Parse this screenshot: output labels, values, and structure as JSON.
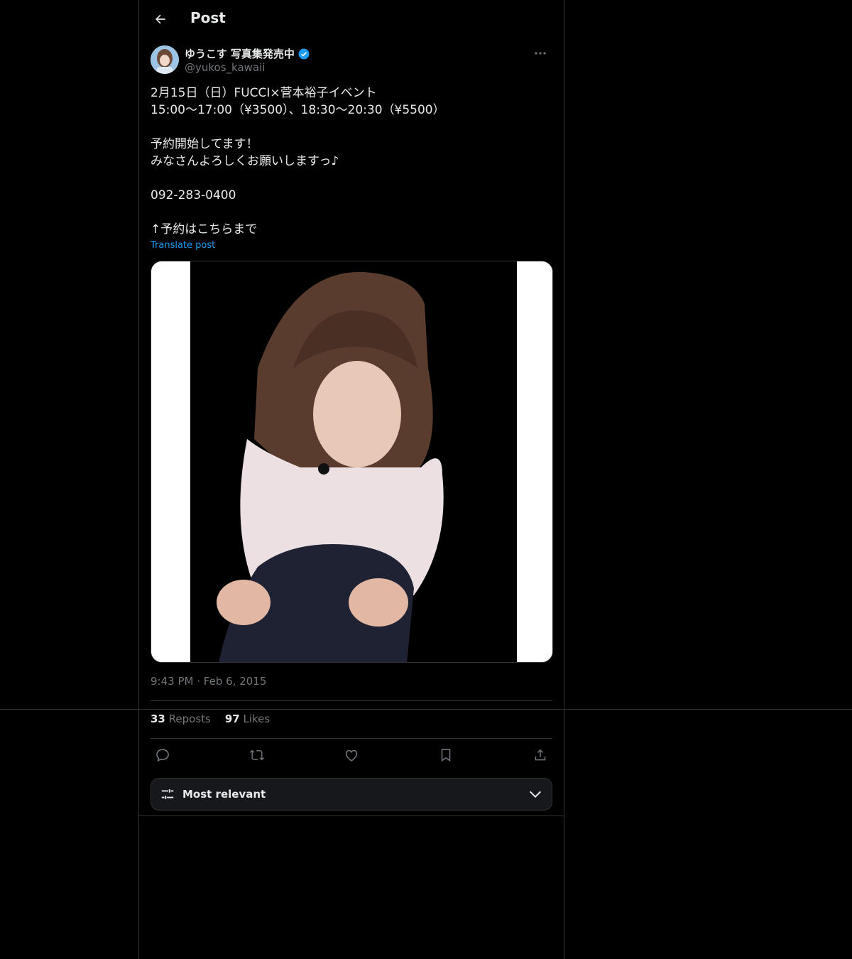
{
  "header": {
    "title": "Post"
  },
  "author": {
    "display_name": "ゆうこす 写真集発売中",
    "handle": "@yukos_kawaii"
  },
  "tweet": {
    "text": "2月15日（日）FUCCI×菅本裕子イベント\n15:00〜17:00（¥3500）、18:30〜20:30（¥5500）\n\n予約開始してます！\nみなさんよろしくお願いしますっ♪\n\n092-283-0400\n\n↑予約はこちらまで",
    "translate_label": "Translate post",
    "time": "9:43 PM",
    "separator": "·",
    "date": "Feb 6, 2015"
  },
  "stats": {
    "reposts_count": "33",
    "reposts_label": "Reposts",
    "likes_count": "97",
    "likes_label": "Likes"
  },
  "sort": {
    "label": "Most relevant"
  },
  "colors": {
    "background": "#000000",
    "border": "#2f3336",
    "text": "#e7e9ea",
    "muted": "#71767b",
    "accent": "#1d9bf0"
  },
  "icons": [
    "back-arrow-icon",
    "verified-badge-icon",
    "more-icon",
    "reply-icon",
    "repost-icon",
    "like-icon",
    "bookmark-icon",
    "share-icon",
    "sort-filter-icon",
    "chevron-down-icon"
  ]
}
